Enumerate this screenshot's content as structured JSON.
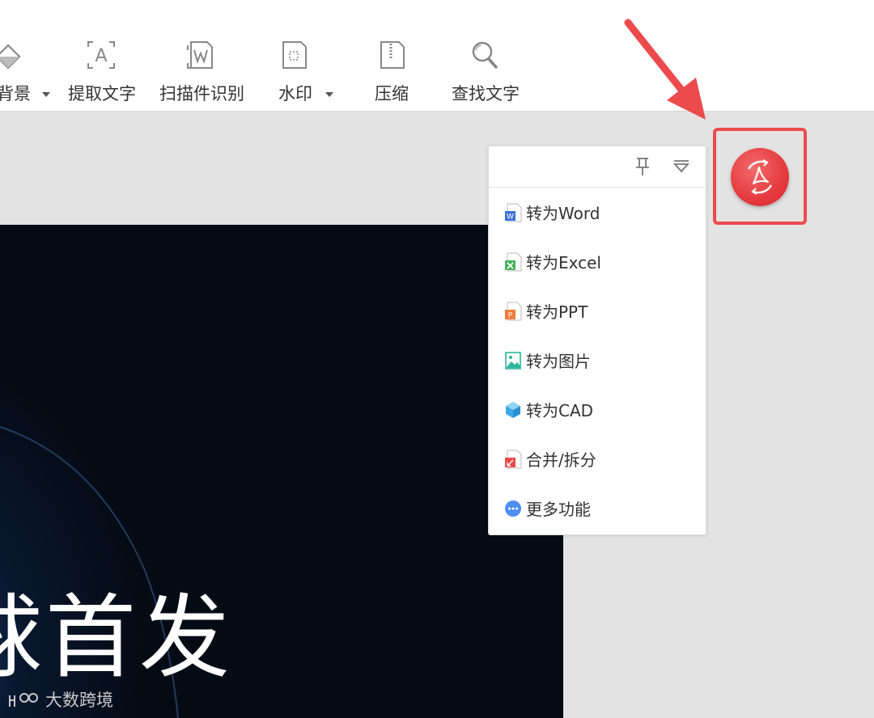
{
  "toolbar": {
    "items": [
      {
        "label": "背景",
        "icon": "background-fill-icon",
        "dropdown": true
      },
      {
        "label": "提取文字",
        "icon": "extract-text-icon",
        "dropdown": false
      },
      {
        "label": "扫描件识别",
        "icon": "scan-recognize-icon",
        "dropdown": false
      },
      {
        "label": "水印",
        "icon": "watermark-icon",
        "dropdown": true
      },
      {
        "label": "压缩",
        "icon": "compress-icon",
        "dropdown": false
      },
      {
        "label": "查找文字",
        "icon": "search-icon",
        "dropdown": false
      }
    ]
  },
  "document": {
    "title_text": "球首发",
    "watermark_text": "大数跨境"
  },
  "convert_panel": {
    "items": [
      {
        "label": "转为Word",
        "icon": "word-file-icon",
        "color": "#3d73d8"
      },
      {
        "label": "转为Excel",
        "icon": "excel-file-icon",
        "color": "#45b25a"
      },
      {
        "label": "转为PPT",
        "icon": "ppt-file-icon",
        "color": "#ef7d3c"
      },
      {
        "label": "转为图片",
        "icon": "image-file-icon",
        "color": "#2bb59a"
      },
      {
        "label": "转为CAD",
        "icon": "cad-cube-icon",
        "color": "#3ea9e8"
      },
      {
        "label": "合并/拆分",
        "icon": "merge-split-icon",
        "color": "#ea4a4a"
      },
      {
        "label": "更多功能",
        "icon": "more-functions-icon",
        "color": "#4f8ef2"
      }
    ]
  },
  "colors": {
    "accent_red": "#ec4a4d",
    "doc_background": "#050b15"
  }
}
